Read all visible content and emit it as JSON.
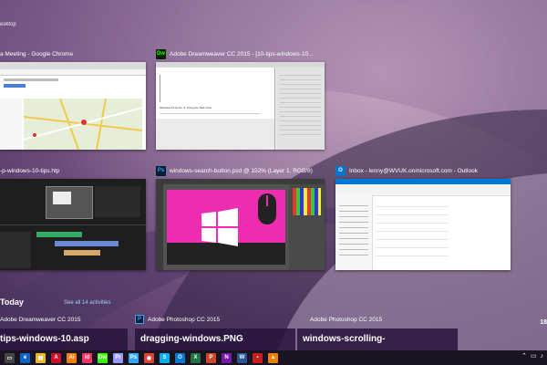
{
  "desktop_label": "esktop",
  "windows": [
    {
      "title": "a Meeting - Google Chrome",
      "icon": "chrome-icon"
    },
    {
      "title": "Adobe Dreamweaver CC 2015 - [10-tips-windows-10...",
      "icon": "dreamweaver-icon",
      "icon_text": "Dw",
      "color": "#35fa00",
      "doc_heading": "Windows 10 tip No. 4: Using the Task View"
    },
    {
      "title": "-p-windows-10-tips.htp",
      "icon": "premiere-icon"
    },
    {
      "title": "windows-search-button.psd @ 152% (Layer 1, RGB/8)",
      "icon": "photoshop-icon",
      "icon_text": "Ps",
      "color": "#31a8ff"
    },
    {
      "title": "Inbox - lenny@WVUK.onmicrosoft.com - Outlook",
      "icon": "outlook-icon",
      "icon_text": "O",
      "color": "#0078d4"
    }
  ],
  "timeline": {
    "heading": "Today",
    "see_all": "See all 14 activities",
    "activities": [
      {
        "app": "Adobe Dreamweaver CC 2015",
        "file": "tips-windows-10.asp",
        "icon": "dreamweaver-icon"
      },
      {
        "app": "Adobe Photoshop CC 2015",
        "file": "dragging-windows.PNG",
        "icon": "photoshop-icon"
      },
      {
        "app": "Adobe Photoshop CC 2015",
        "file": "windows-scrolling-",
        "icon": "photoshop-icon"
      }
    ],
    "edge_date": "18"
  },
  "taskbar": {
    "apps": [
      {
        "name": "task-view-icon",
        "text": "▭",
        "color": "#444"
      },
      {
        "name": "edge-icon",
        "text": "e",
        "color": "#0a64c8"
      },
      {
        "name": "file-explorer-icon",
        "text": "▤",
        "color": "#e6b92b"
      },
      {
        "name": "acrobat-icon",
        "text": "A",
        "color": "#c8102e"
      },
      {
        "name": "illustrator-icon",
        "text": "Ai",
        "color": "#ff7c00"
      },
      {
        "name": "indesign-icon",
        "text": "Id",
        "color": "#ff3366"
      },
      {
        "name": "dreamweaver-icon",
        "text": "Dw",
        "color": "#35fa00"
      },
      {
        "name": "premiere-icon",
        "text": "Pr",
        "color": "#9999ff"
      },
      {
        "name": "photoshop-icon",
        "text": "Ps",
        "color": "#31a8ff"
      },
      {
        "name": "chrome-icon",
        "text": "◉",
        "color": "#db4437"
      },
      {
        "name": "skype-icon",
        "text": "S",
        "color": "#00aff0"
      },
      {
        "name": "outlook-icon",
        "text": "O",
        "color": "#0078d4"
      },
      {
        "name": "excel-icon",
        "text": "X",
        "color": "#217346"
      },
      {
        "name": "powerpoint-icon",
        "text": "P",
        "color": "#d24726"
      },
      {
        "name": "onenote-icon",
        "text": "N",
        "color": "#7719aa"
      },
      {
        "name": "word-icon",
        "text": "W",
        "color": "#2b579a"
      },
      {
        "name": "app-red-icon",
        "text": "▪",
        "color": "#c81e1e"
      },
      {
        "name": "vlc-icon",
        "text": "▲",
        "color": "#f08000"
      }
    ],
    "tray_icons": [
      "chevron-up-icon",
      "network-icon",
      "volume-icon"
    ]
  }
}
